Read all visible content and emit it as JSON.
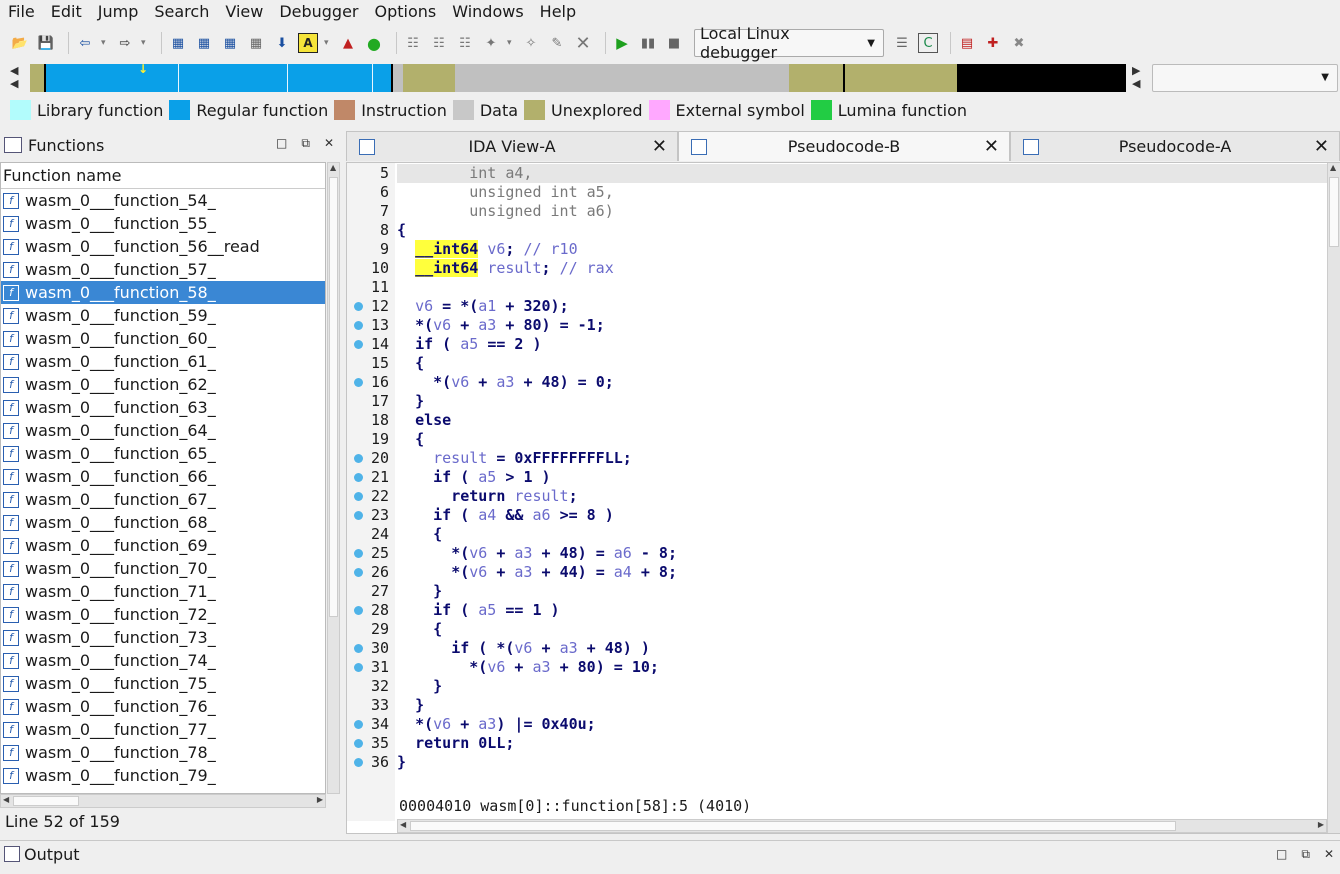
{
  "menu": [
    "File",
    "Edit",
    "Jump",
    "Search",
    "View",
    "Debugger",
    "Options",
    "Windows",
    "Help"
  ],
  "toolbar": {
    "debugger_select": "Local Linux debugger"
  },
  "navband_colors": {
    "regular": "#0aa0e8",
    "unexplored": "#b2b06c",
    "data": "#c0c0c0",
    "black": "#000000"
  },
  "legend": [
    {
      "label": "Library function",
      "color": "#b2fcfc"
    },
    {
      "label": "Regular function",
      "color": "#0aa0e8"
    },
    {
      "label": "Instruction",
      "color": "#c08868"
    },
    {
      "label": "Data",
      "color": "#c8c8c8"
    },
    {
      "label": "Unexplored",
      "color": "#b2b06c"
    },
    {
      "label": "External symbol",
      "color": "#ffa8ff"
    },
    {
      "label": "Lumina function",
      "color": "#22cc44"
    }
  ],
  "functions_panel": {
    "title": "Functions",
    "column_header": "Function name",
    "items": [
      "wasm_0___function_54_",
      "wasm_0___function_55_",
      "wasm_0___function_56__read",
      "wasm_0___function_57_",
      "wasm_0___function_58_",
      "wasm_0___function_59_",
      "wasm_0___function_60_",
      "wasm_0___function_61_",
      "wasm_0___function_62_",
      "wasm_0___function_63_",
      "wasm_0___function_64_",
      "wasm_0___function_65_",
      "wasm_0___function_66_",
      "wasm_0___function_67_",
      "wasm_0___function_68_",
      "wasm_0___function_69_",
      "wasm_0___function_70_",
      "wasm_0___function_71_",
      "wasm_0___function_72_",
      "wasm_0___function_73_",
      "wasm_0___function_74_",
      "wasm_0___function_75_",
      "wasm_0___function_76_",
      "wasm_0___function_77_",
      "wasm_0___function_78_",
      "wasm_0___function_79_"
    ],
    "selected_index": 4,
    "status": "Line 52 of 159"
  },
  "tabs": [
    {
      "label": "IDA View-A",
      "active": false
    },
    {
      "label": "Pseudocode-B",
      "active": true
    },
    {
      "label": "Pseudocode-A",
      "active": false
    }
  ],
  "code": {
    "lines": [
      {
        "n": "5",
        "bp": false,
        "text": "        int a4,"
      },
      {
        "n": "6",
        "bp": false,
        "text": "        unsigned int a5,"
      },
      {
        "n": "7",
        "bp": false,
        "text": "        unsigned int a6)"
      },
      {
        "n": "8",
        "bp": false,
        "text": "{"
      },
      {
        "n": "9",
        "bp": false,
        "text": "  __int64 v6; // r10"
      },
      {
        "n": "10",
        "bp": false,
        "text": "  __int64 result; // rax"
      },
      {
        "n": "11",
        "bp": false,
        "text": ""
      },
      {
        "n": "12",
        "bp": true,
        "text": "  v6 = *(a1 + 320);"
      },
      {
        "n": "13",
        "bp": true,
        "text": "  *(v6 + a3 + 80) = -1;"
      },
      {
        "n": "14",
        "bp": true,
        "text": "  if ( a5 == 2 )"
      },
      {
        "n": "15",
        "bp": false,
        "text": "  {"
      },
      {
        "n": "16",
        "bp": true,
        "text": "    *(v6 + a3 + 48) = 0;"
      },
      {
        "n": "17",
        "bp": false,
        "text": "  }"
      },
      {
        "n": "18",
        "bp": false,
        "text": "  else"
      },
      {
        "n": "19",
        "bp": false,
        "text": "  {"
      },
      {
        "n": "20",
        "bp": true,
        "text": "    result = 0xFFFFFFFFLL;"
      },
      {
        "n": "21",
        "bp": true,
        "text": "    if ( a5 > 1 )"
      },
      {
        "n": "22",
        "bp": true,
        "text": "      return result;"
      },
      {
        "n": "23",
        "bp": true,
        "text": "    if ( a4 && a6 >= 8 )"
      },
      {
        "n": "24",
        "bp": false,
        "text": "    {"
      },
      {
        "n": "25",
        "bp": true,
        "text": "      *(v6 + a3 + 48) = a6 - 8;"
      },
      {
        "n": "26",
        "bp": true,
        "text": "      *(v6 + a3 + 44) = a4 + 8;"
      },
      {
        "n": "27",
        "bp": false,
        "text": "    }"
      },
      {
        "n": "28",
        "bp": true,
        "text": "    if ( a5 == 1 )"
      },
      {
        "n": "29",
        "bp": false,
        "text": "    {"
      },
      {
        "n": "30",
        "bp": true,
        "text": "      if ( *(v6 + a3 + 48) )"
      },
      {
        "n": "31",
        "bp": true,
        "text": "        *(v6 + a3 + 80) = 10;"
      },
      {
        "n": "32",
        "bp": false,
        "text": "    }"
      },
      {
        "n": "33",
        "bp": false,
        "text": "  }"
      },
      {
        "n": "34",
        "bp": true,
        "text": "  *(v6 + a3) |= 0x40u;"
      },
      {
        "n": "35",
        "bp": true,
        "text": "  return 0LL;"
      },
      {
        "n": "36",
        "bp": true,
        "text": "}"
      }
    ],
    "status": "00004010 wasm[0]::function[58]:5 (4010)"
  },
  "output_panel": {
    "title": "Output"
  }
}
